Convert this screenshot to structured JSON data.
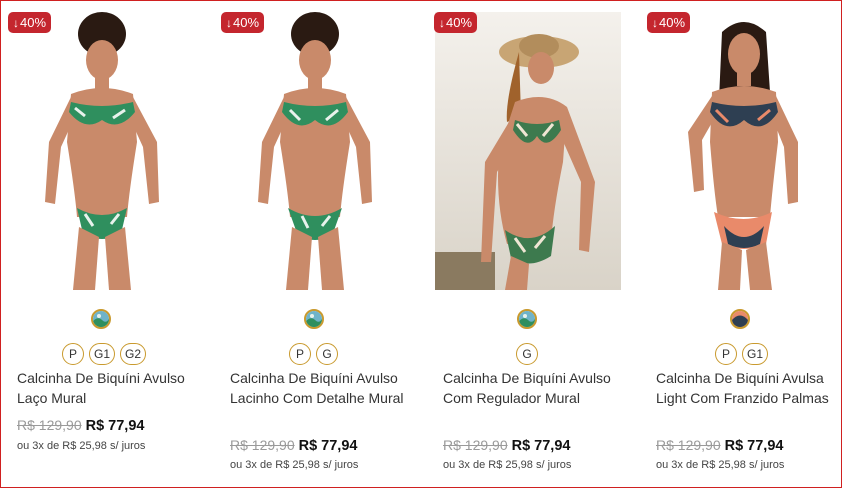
{
  "products": [
    {
      "discount": "40%",
      "discount_arrow": "↓",
      "sizes": [
        "P",
        "G1",
        "G2"
      ],
      "name": "Calcinha De Biquíni Avulso Laço Mural",
      "old_price": "R$ 129,90",
      "price": "R$ 77,94",
      "installments": "ou 3x de R$ 25,98 s/ juros",
      "swatch_icon": "green-print-swatch-icon"
    },
    {
      "discount": "40%",
      "discount_arrow": "↓",
      "sizes": [
        "P",
        "G"
      ],
      "name": "Calcinha De Biquíni Avulso Lacinho Com Detalhe Mural",
      "old_price": "R$ 129,90",
      "price": "R$ 77,94",
      "installments": "ou 3x de R$ 25,98 s/ juros",
      "swatch_icon": "green-print-swatch-icon"
    },
    {
      "discount": "40%",
      "discount_arrow": "↓",
      "sizes": [
        "G"
      ],
      "name": "Calcinha De Biquíni Avulso Com Regulador Mural",
      "old_price": "R$ 129,90",
      "price": "R$ 77,94",
      "installments": "ou 3x de R$ 25,98 s/ juros",
      "swatch_icon": "green-print-swatch-icon"
    },
    {
      "discount": "40%",
      "discount_arrow": "↓",
      "sizes": [
        "P",
        "G1"
      ],
      "name": "Calcinha De Biquíni Avulsa Light Com Franzido Palmas",
      "old_price": "R$ 129,90",
      "price": "R$ 77,94",
      "installments": "ou 3x de R$ 25,98 s/ juros",
      "swatch_icon": "navy-palm-swatch-icon"
    }
  ],
  "colors": {
    "badge": "#c4262e",
    "size_border": "#c99a2e",
    "frame_border": "#d02020"
  }
}
